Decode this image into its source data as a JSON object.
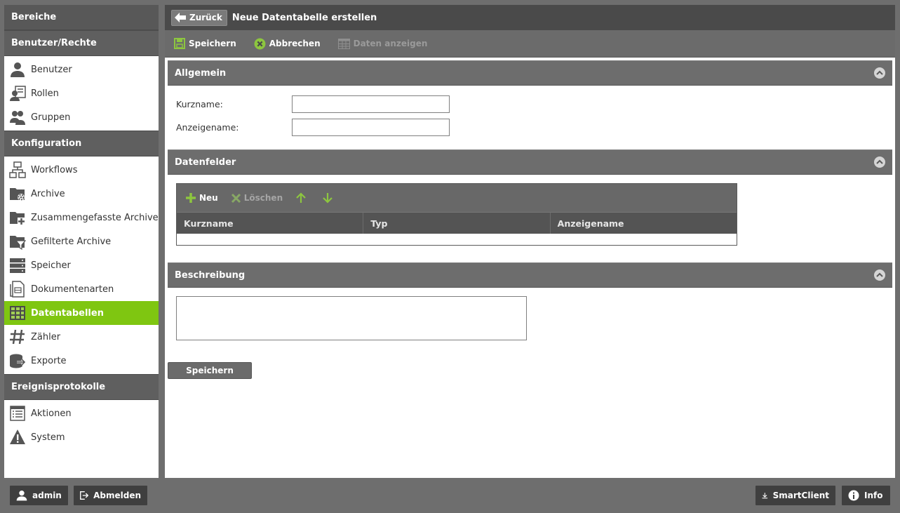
{
  "sidebar": {
    "header": "Bereiche",
    "sections": [
      {
        "title": "Benutzer/Rechte",
        "items": [
          {
            "label": "Benutzer",
            "icon": "user-icon"
          },
          {
            "label": "Rollen",
            "icon": "roles-icon"
          },
          {
            "label": "Gruppen",
            "icon": "group-icon"
          }
        ]
      },
      {
        "title": "Konfiguration",
        "items": [
          {
            "label": "Workflows",
            "icon": "workflow-icon"
          },
          {
            "label": "Archive",
            "icon": "archive-settings-icon"
          },
          {
            "label": "Zusammengefasste Archive",
            "icon": "archive-add-icon"
          },
          {
            "label": "Gefilterte Archive",
            "icon": "archive-filter-icon"
          },
          {
            "label": "Speicher",
            "icon": "storage-icon"
          },
          {
            "label": "Dokumentenarten",
            "icon": "document-types-icon"
          },
          {
            "label": "Datentabellen",
            "icon": "table-icon",
            "active": true
          },
          {
            "label": "Zähler",
            "icon": "hash-icon"
          },
          {
            "label": "Exporte",
            "icon": "export-icon"
          }
        ]
      },
      {
        "title": "Ereignisprotokolle",
        "items": [
          {
            "label": "Aktionen",
            "icon": "list-icon"
          },
          {
            "label": "System",
            "icon": "warning-icon"
          }
        ]
      }
    ]
  },
  "header": {
    "back_label": "Zurück",
    "title": "Neue Datentabelle erstellen"
  },
  "toolbar": {
    "save_label": "Speichern",
    "cancel_label": "Abbrechen",
    "show_data_label": "Daten anzeigen"
  },
  "general": {
    "title": "Allgemein",
    "shortname_label": "Kurzname:",
    "shortname_value": "",
    "displayname_label": "Anzeigename:",
    "displayname_value": ""
  },
  "fields": {
    "title": "Datenfelder",
    "new_label": "Neu",
    "delete_label": "Löschen",
    "columns": [
      "Kurzname",
      "Typ",
      "Anzeigename"
    ],
    "rows": []
  },
  "description": {
    "title": "Beschreibung",
    "value": ""
  },
  "save_button": "Speichern",
  "footer": {
    "user_label": "admin",
    "logout_label": "Abmelden",
    "smartclient_label": "SmartClient",
    "info_label": "Info"
  },
  "colors": {
    "accent": "#7fc611",
    "header_dark": "#4a4a4a",
    "panel": "#6d6d6d"
  }
}
